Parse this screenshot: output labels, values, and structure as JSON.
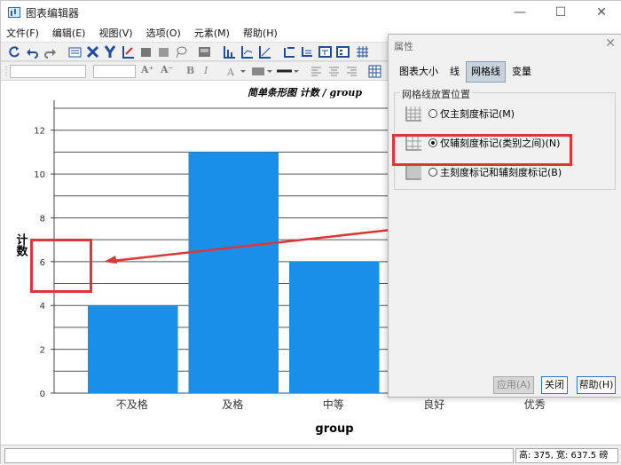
{
  "window": {
    "title": "图表编辑器",
    "minimize": "—",
    "maximize": "☐",
    "close": "✕"
  },
  "menu": [
    "文件(F)",
    "编辑(E)",
    "视图(V)",
    "选项(O)",
    "元素(M)",
    "帮助(H)"
  ],
  "toolbar": {
    "font_bold": "B",
    "font_italic": "I",
    "font_grow": "A⁺",
    "font_shrink": "A⁻"
  },
  "chart_data": {
    "type": "bar",
    "title": "简单条形图 计数 / group",
    "categories": [
      "不及格",
      "及格",
      "中等",
      "良好",
      "优秀"
    ],
    "values": [
      4,
      11,
      6,
      null,
      null
    ],
    "xlabel": "group",
    "ylabel": "计数",
    "ylim": [
      0,
      13
    ],
    "yticks": [
      0,
      2,
      4,
      6,
      8,
      10,
      12
    ],
    "bar_color": "#1a8fe8",
    "gridlines": "minor-between"
  },
  "properties": {
    "title": "属性",
    "close": "✕",
    "tabs": [
      "图表大小",
      "线",
      "网格线",
      "变量"
    ],
    "active_tab": "网格线",
    "group_title": "网格线放置位置",
    "options": [
      {
        "label": "仅主刻度标记(M)",
        "selected": false
      },
      {
        "label": "仅辅刻度标记(类别之间)(N)",
        "selected": true
      },
      {
        "label": "主刻度标记和辅刻度标记(B)",
        "selected": false
      }
    ],
    "buttons": {
      "apply": "应用(A)",
      "close": "关闭",
      "help": "帮助(H)"
    }
  },
  "status": {
    "left": "",
    "right": "高: 375, 宽: 637.5 磅"
  },
  "colors": {
    "highlight": "#e03535",
    "accent": "#2e6fd0",
    "bar": "#1a8fe8"
  }
}
